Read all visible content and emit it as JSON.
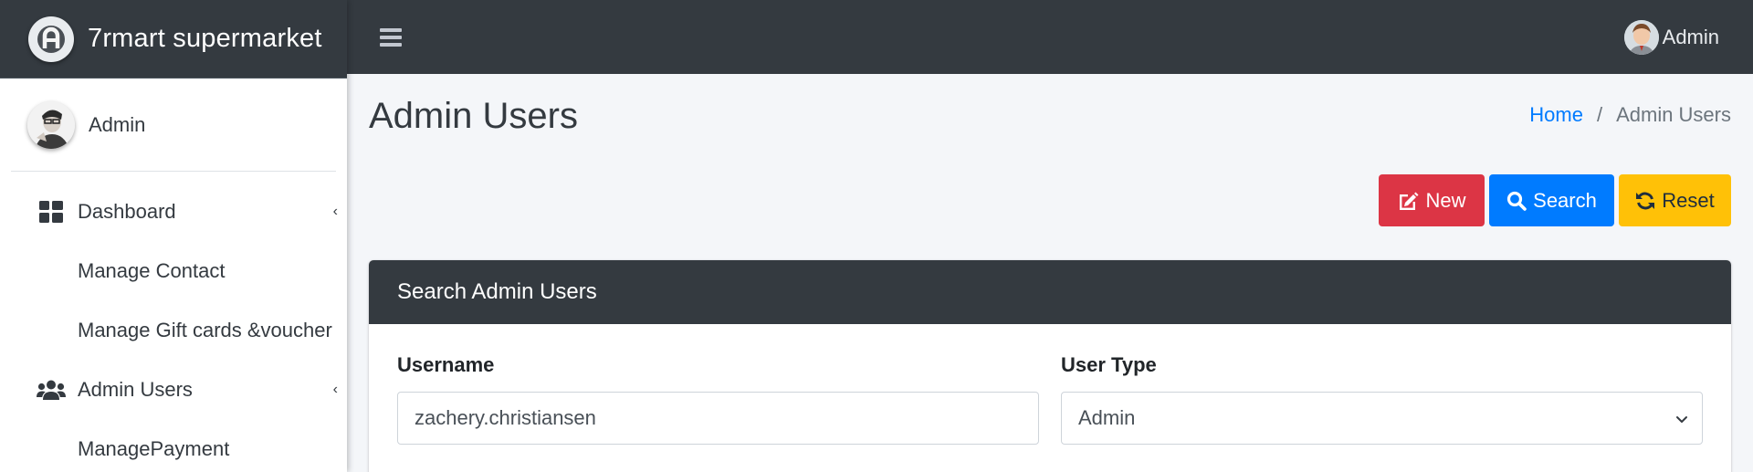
{
  "brand": {
    "name": "7rmart supermarket",
    "logo_icon": "brand-logo-icon"
  },
  "sidebar_user": {
    "name": "Admin"
  },
  "sidebar": {
    "items": [
      {
        "label": "Dashboard",
        "icon": "dashboard-grid-icon",
        "has_arrow": true
      },
      {
        "label": "Manage Contact",
        "icon": null,
        "has_arrow": false
      },
      {
        "label": "Manage Gift cards &voucher",
        "icon": null,
        "has_arrow": false
      },
      {
        "label": "Admin Users",
        "icon": "users-icon",
        "has_arrow": true
      },
      {
        "label": "ManagePayment",
        "icon": null,
        "has_arrow": false
      }
    ],
    "arrow_glyph": "‹"
  },
  "topbar": {
    "user_name": "Admin"
  },
  "page": {
    "title": "Admin Users",
    "breadcrumb": {
      "home": "Home",
      "separator": "/",
      "current": "Admin Users"
    }
  },
  "actions": {
    "new_label": "New",
    "search_label": "Search",
    "reset_label": "Reset"
  },
  "search_card": {
    "title": "Search Admin Users",
    "username_label": "Username",
    "username_value": "zachery.christiansen",
    "user_type_label": "User Type",
    "user_type_value": "Admin"
  },
  "colors": {
    "dark": "#343a40",
    "danger": "#dc3545",
    "primary": "#007bff",
    "warning": "#ffc107",
    "background": "#f4f6f9"
  }
}
